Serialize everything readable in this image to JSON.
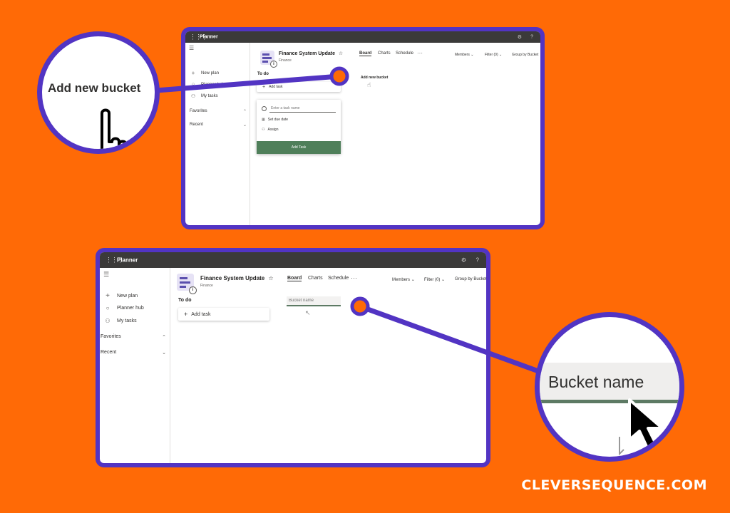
{
  "app": {
    "name": "Planner",
    "waffle_glyph": "⋮⋮⋮",
    "settings_glyph": "⚙",
    "help_glyph": "?"
  },
  "nav": {
    "hamburger_glyph": "☰",
    "items": [
      {
        "label": "New plan",
        "icon": "plus-icon",
        "glyph": "+"
      },
      {
        "label": "Planner hub",
        "icon": "circle-icon",
        "glyph": "○"
      },
      {
        "label": "My tasks",
        "icon": "person-icon",
        "glyph": "⚇"
      }
    ],
    "favorites_label": "Favorites",
    "recent_label": "Recent",
    "chev_up": "⌃",
    "chev_down": "⌄"
  },
  "plan": {
    "title": "Finance System Update",
    "star_glyph": "☆",
    "group": "Finance",
    "badge": "i"
  },
  "tabs": [
    {
      "label": "Board",
      "active": true
    },
    {
      "label": "Charts",
      "active": false
    },
    {
      "label": "Schedule",
      "active": false
    }
  ],
  "more_glyph": "···",
  "filters": {
    "members": "Members",
    "filter": "Filter (0)",
    "group_by": "Group by Bucket",
    "chevron": "⌄"
  },
  "board": {
    "bucket_title": "To do",
    "add_task_label": "Add task",
    "add_glyph": "+",
    "add_new_bucket_label": "Add new bucket",
    "task_form": {
      "name_placeholder": "Enter a task name",
      "due_date_label": "Set due date",
      "due_glyph": "▦",
      "assign_label": "Assign",
      "assign_glyph": "⚇",
      "submit_label": "Add Task"
    },
    "bucket_name_placeholder": "Bucket name"
  },
  "zoom1": {
    "text": "Add new bucket"
  },
  "zoom2": {
    "text": "Bucket name"
  },
  "annotation": {
    "color": "#5234c3",
    "marker_color": "#ff6a06"
  },
  "watermark": "CLEVERSEQUENCE.COM"
}
